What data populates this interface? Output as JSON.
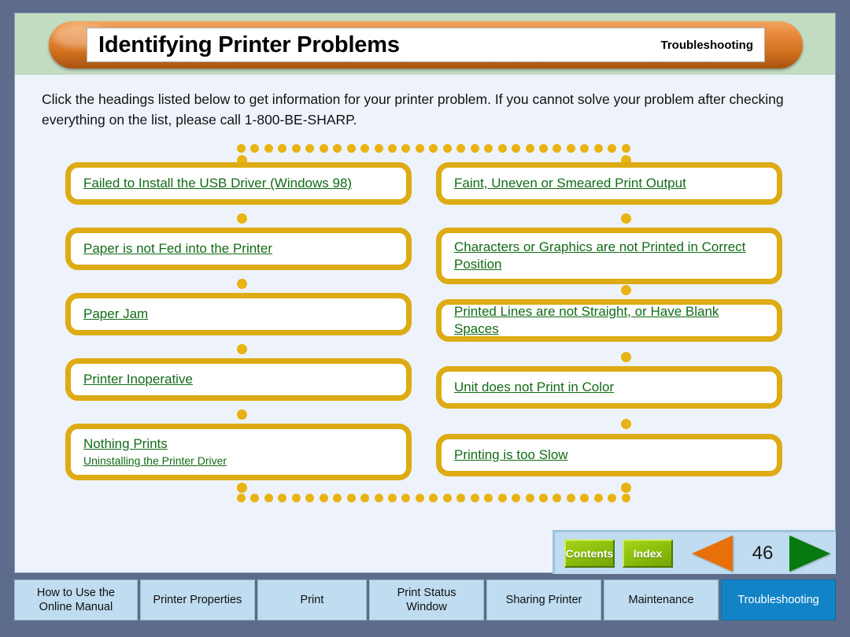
{
  "header": {
    "title": "Identifying Printer Problems",
    "section": "Troubleshooting"
  },
  "intro": {
    "text": "Click the headings listed below to get information for your printer problem. If you cannot solve your problem after checking everything on the list, please call 1-800-BE-SHARP."
  },
  "flow": {
    "left_column": [
      {
        "label": "Failed to Install the USB Driver (Windows 98)"
      },
      {
        "label": "Paper is not Fed into the Printer"
      },
      {
        "label": "Paper Jam"
      },
      {
        "label": "Printer Inoperative"
      },
      {
        "label": "Nothing Prints",
        "sub_label": "Uninstalling the Printer Driver"
      }
    ],
    "right_column": [
      {
        "label": "Faint, Uneven or Smeared Print Output"
      },
      {
        "label": "Characters or Graphics are not Printed in Correct Position"
      },
      {
        "label": "Printed Lines are not Straight, or Have Blank Spaces"
      },
      {
        "label": "Unit does not Print in Color"
      },
      {
        "label": "Printing is too Slow"
      }
    ]
  },
  "nav": {
    "contents_label": "Contents",
    "index_label": "Index",
    "page_number": "46",
    "prev_icon": "left-triangle-icon",
    "next_icon": "right-triangle-icon"
  },
  "tabs": [
    {
      "label": "How to Use the\nOnline Manual",
      "line1": "How to Use the",
      "line2": "Online Manual",
      "active": false
    },
    {
      "label": "Printer Properties",
      "line1": "Printer Properties",
      "line2": "",
      "active": false
    },
    {
      "label": "Print",
      "line1": "Print",
      "line2": "",
      "active": false
    },
    {
      "label": "Print Status Window",
      "line1": "Print Status",
      "line2": "Window",
      "active": false
    },
    {
      "label": "Sharing Printer",
      "line1": "Sharing Printer",
      "line2": "",
      "active": false
    },
    {
      "label": "Maintenance",
      "line1": "Maintenance",
      "line2": "",
      "active": false
    },
    {
      "label": "Troubleshooting",
      "line1": "Troubleshooting",
      "line2": "",
      "active": true
    }
  ],
  "colors": {
    "outer_frame": "#5e6c8c",
    "header_band": "#c2dcc2",
    "header_pill": "#d4731f",
    "body_bg": "#eef3fb",
    "box_border": "#ddab14",
    "dot": "#e8b313",
    "link_text": "#126b16",
    "tab_bg": "#bfdcf0",
    "tab_active_bg": "#1283c6",
    "nav_button": "#8cc10d",
    "prev_arrow": "#e8700a",
    "next_arrow": "#067a0f"
  }
}
